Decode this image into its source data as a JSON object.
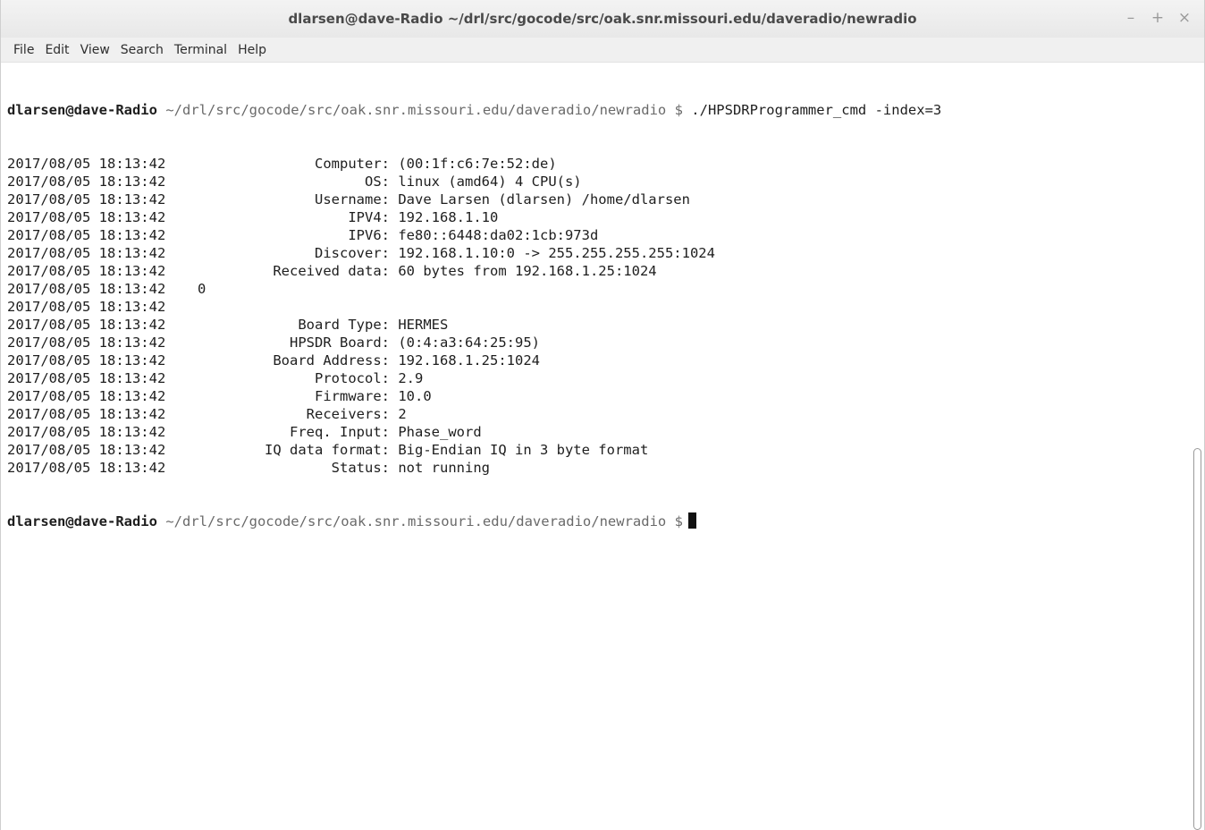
{
  "window": {
    "title": "dlarsen@dave-Radio ~/drl/src/gocode/src/oak.snr.missouri.edu/daveradio/newradio",
    "controls": {
      "minimize": "–",
      "maximize": "+",
      "close": "×"
    }
  },
  "menubar": {
    "items": [
      "File",
      "Edit",
      "View",
      "Search",
      "Terminal",
      "Help"
    ]
  },
  "terminal": {
    "prompt_user": "dlarsen@dave-Radio",
    "prompt_path": "~/drl/src/gocode/src/oak.snr.missouri.edu/daveradio/newradio",
    "prompt_symbol": "$",
    "command": "./HPSDRProgrammer_cmd -index=3",
    "log_lines": [
      {
        "timestamp": "2017/08/05 18:13:42",
        "key": "Computer:",
        "value": "(00:1f:c6:7e:52:de)"
      },
      {
        "timestamp": "2017/08/05 18:13:42",
        "key": "OS:",
        "value": "linux (amd64) 4 CPU(s)"
      },
      {
        "timestamp": "2017/08/05 18:13:42",
        "key": "Username:",
        "value": "Dave Larsen (dlarsen) /home/dlarsen"
      },
      {
        "timestamp": "2017/08/05 18:13:42",
        "key": "IPV4:",
        "value": "192.168.1.10"
      },
      {
        "timestamp": "2017/08/05 18:13:42",
        "key": "IPV6:",
        "value": "fe80::6448:da02:1cb:973d"
      },
      {
        "timestamp": "2017/08/05 18:13:42",
        "key": "Discover:",
        "value": "192.168.1.10:0 -> 255.255.255.255:1024"
      },
      {
        "timestamp": "2017/08/05 18:13:42",
        "key": "Received data:",
        "value": "60 bytes from 192.168.1.25:1024"
      },
      {
        "timestamp": "2017/08/05 18:13:42",
        "key": "",
        "value": "0",
        "raw": true
      },
      {
        "timestamp": "2017/08/05 18:13:42",
        "key": "",
        "value": "",
        "raw": true
      },
      {
        "timestamp": "2017/08/05 18:13:42",
        "key": "Board Type:",
        "value": "HERMES"
      },
      {
        "timestamp": "2017/08/05 18:13:42",
        "key": "HPSDR Board:",
        "value": "(0:4:a3:64:25:95)"
      },
      {
        "timestamp": "2017/08/05 18:13:42",
        "key": "Board Address:",
        "value": "192.168.1.25:1024"
      },
      {
        "timestamp": "2017/08/05 18:13:42",
        "key": "Protocol:",
        "value": "2.9"
      },
      {
        "timestamp": "2017/08/05 18:13:42",
        "key": "Firmware:",
        "value": "10.0"
      },
      {
        "timestamp": "2017/08/05 18:13:42",
        "key": "Receivers:",
        "value": "2"
      },
      {
        "timestamp": "2017/08/05 18:13:42",
        "key": "Freq. Input:",
        "value": "Phase_word"
      },
      {
        "timestamp": "2017/08/05 18:13:42",
        "key": "IQ data format:",
        "value": "Big-Endian IQ in 3 byte format"
      },
      {
        "timestamp": "2017/08/05 18:13:42",
        "key": "Status:",
        "value": "not running"
      }
    ]
  }
}
